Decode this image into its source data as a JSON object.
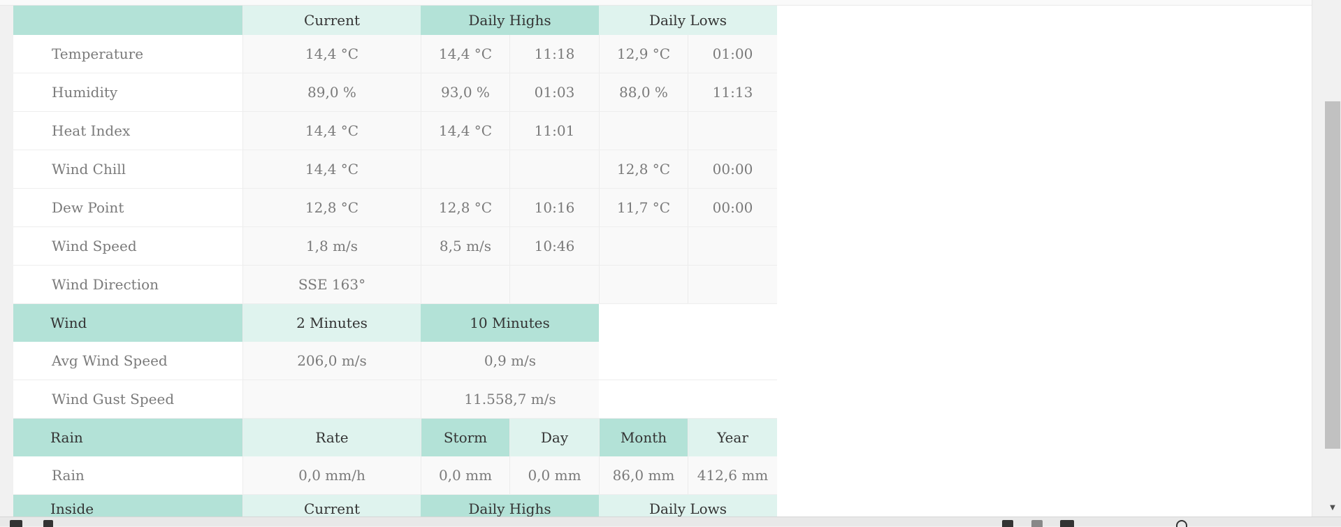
{
  "outside_header": {
    "label": "",
    "current": "Current",
    "daily_highs": "Daily Highs",
    "daily_lows": "Daily Lows"
  },
  "outside_rows": [
    {
      "label": "Temperature",
      "current": "14,4 °C",
      "high": "14,4 °C",
      "high_time": "11:18",
      "low": "12,9 °C",
      "low_time": "01:00"
    },
    {
      "label": "Humidity",
      "current": "89,0 %",
      "high": "93,0 %",
      "high_time": "01:03",
      "low": "88,0 %",
      "low_time": "11:13"
    },
    {
      "label": "Heat Index",
      "current": "14,4 °C",
      "high": "14,4 °C",
      "high_time": "11:01",
      "low": "",
      "low_time": ""
    },
    {
      "label": "Wind Chill",
      "current": "14,4 °C",
      "high": "",
      "high_time": "",
      "low": "12,8 °C",
      "low_time": "00:00"
    },
    {
      "label": "Dew Point",
      "current": "12,8 °C",
      "high": "12,8 °C",
      "high_time": "10:16",
      "low": "11,7 °C",
      "low_time": "00:00"
    },
    {
      "label": "Wind Speed",
      "current": "1,8 m/s",
      "high": "8,5 m/s",
      "high_time": "10:46",
      "low": "",
      "low_time": ""
    },
    {
      "label": "Wind Direction",
      "current": "SSE 163°",
      "high": "",
      "high_time": "",
      "low": "",
      "low_time": ""
    }
  ],
  "wind_header": {
    "label": "Wind",
    "col1": "2 Minutes",
    "col2": "10 Minutes"
  },
  "wind_rows": [
    {
      "label": "Avg Wind Speed",
      "col1": "206,0 m/s",
      "col2": "0,9 m/s"
    },
    {
      "label": "Wind Gust Speed",
      "col1": "",
      "col2": "11.558,7 m/s"
    }
  ],
  "rain_header": {
    "label": "Rain",
    "rate": "Rate",
    "storm": "Storm",
    "day": "Day",
    "month": "Month",
    "year": "Year"
  },
  "rain_row": {
    "label": "Rain",
    "rate": "0,0 mm/h",
    "storm": "0,0 mm",
    "day": "0,0 mm",
    "month": "86,0 mm",
    "year": "412,6 mm"
  },
  "inside_header": {
    "label": "Inside",
    "current": "Current",
    "daily_highs": "Daily Highs",
    "daily_lows": "Daily Lows"
  },
  "colors": {
    "header_dark": "#b3e2d7",
    "header_light": "#dff3ee",
    "text": "#7a7a7a"
  }
}
